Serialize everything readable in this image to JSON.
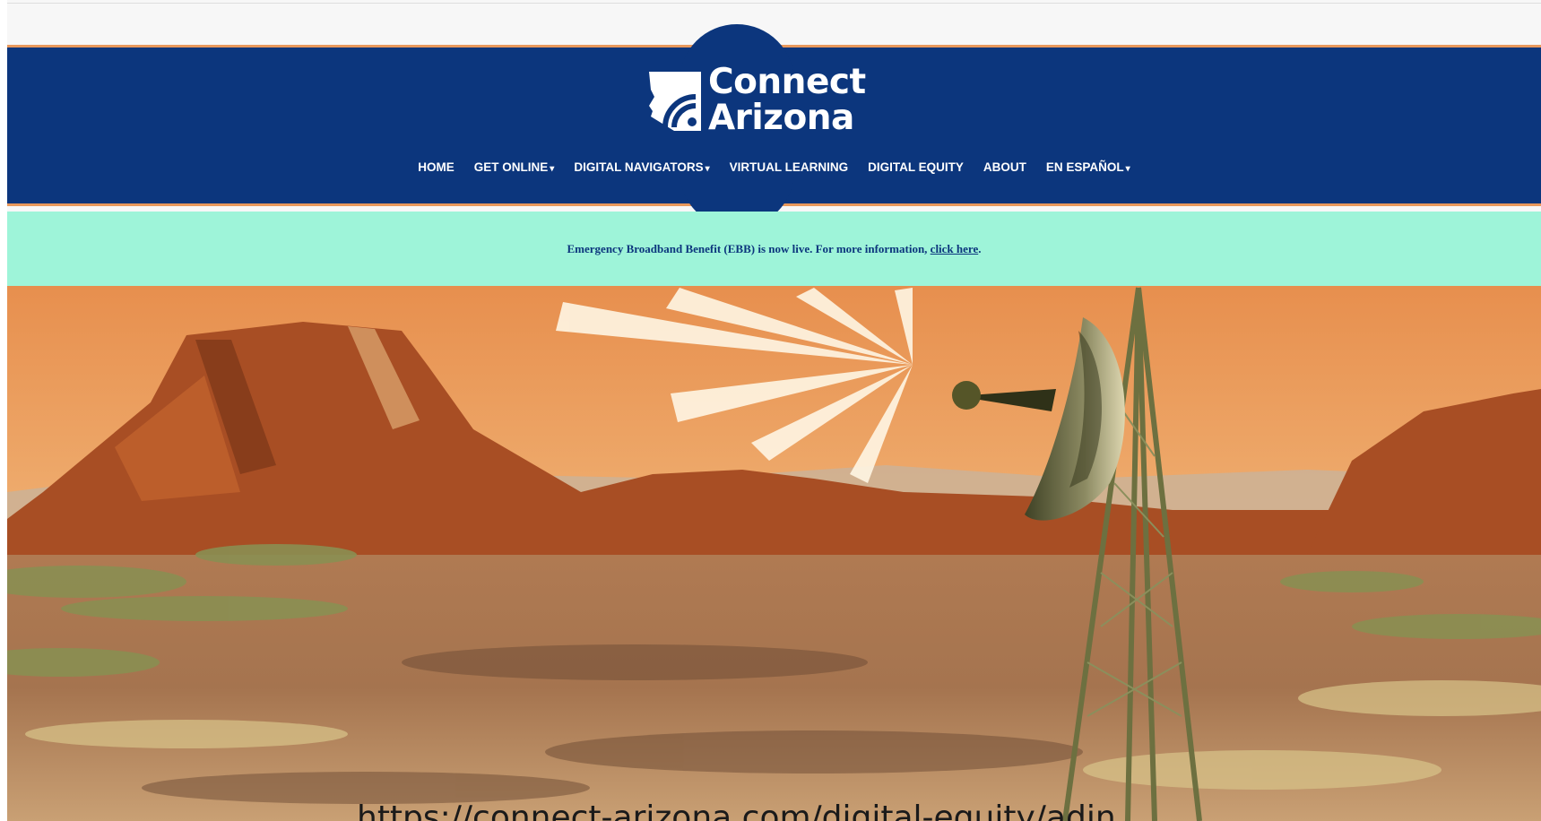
{
  "logo": {
    "line1": "Connect",
    "line2": "Arizona",
    "mark_icon": "arizona-wifi-logo-icon"
  },
  "nav": {
    "items": [
      {
        "label": "HOME",
        "has_dropdown": false
      },
      {
        "label": "GET ONLINE",
        "has_dropdown": true
      },
      {
        "label": "DIGITAL NAVIGATORS",
        "has_dropdown": true
      },
      {
        "label": "VIRTUAL LEARNING",
        "has_dropdown": false
      },
      {
        "label": "DIGITAL EQUITY",
        "has_dropdown": false
      },
      {
        "label": "ABOUT",
        "has_dropdown": false
      },
      {
        "label": "EN ESPAÑOL",
        "has_dropdown": true
      }
    ],
    "caret": "▾"
  },
  "banner": {
    "text": "Emergency Broadband Benefit (EBB) is now live. For more information, ",
    "link": "click here",
    "end": "."
  },
  "hero": {
    "icon": "desert-satellite-tower-illustration"
  },
  "overlay": {
    "url_text": "https://connect-arizona.com/digital-equity/adin"
  },
  "colors": {
    "navy": "#0c367d",
    "orange": "#e8985c",
    "mint": "#9ef4d9",
    "white": "#ffffff"
  }
}
